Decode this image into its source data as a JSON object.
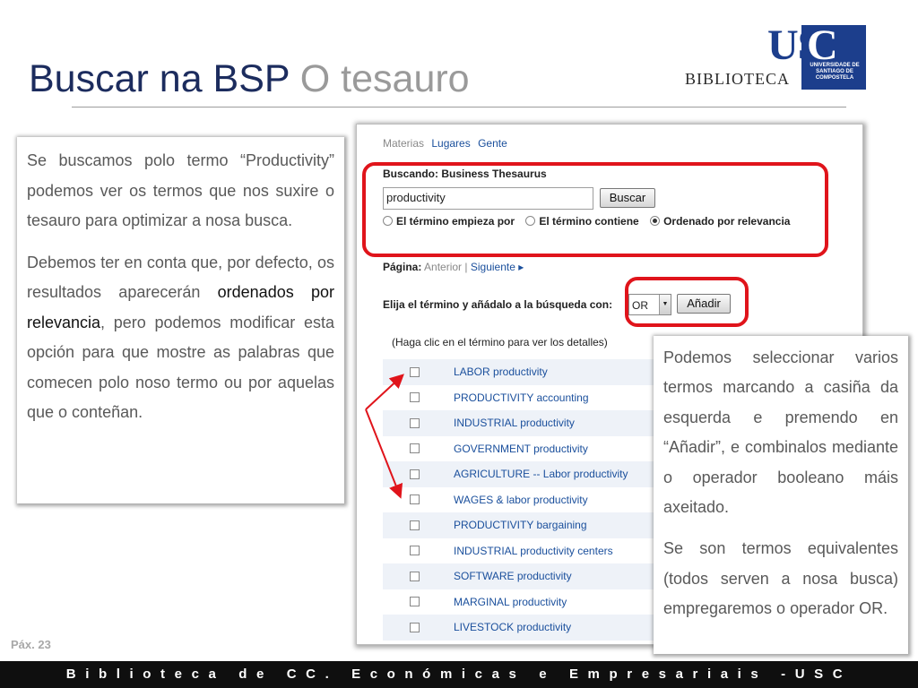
{
  "header": {
    "title_main": "Buscar na BSP",
    "title_sub": "O tesauro",
    "logo_usc": "USC",
    "logo_university": "UNIVERSIDADE DE SANTIAGO DE COMPOSTELA",
    "logo_biblioteca": "BIBLIOTECA"
  },
  "left_box": {
    "p1": "Se buscamos polo termo “Productivity” podemos ver os termos que nos suxire o tesauro para optimizar a nosa busca.",
    "p2_before": "Debemos ter en conta que, por defecto, os resultados aparecerán ",
    "p2_highlight": "ordenados por relevancia",
    "p2_after": ", pero podemos modificar esta opción para que mostre as palabras que comecen polo noso termo ou por aquelas que o conteñan."
  },
  "panel": {
    "tabs": {
      "materias": "Materias",
      "lugares": "Lugares",
      "gente": "Gente"
    },
    "search_label": "Buscando: Business Thesaurus",
    "search_value": "productivity",
    "search_button": "Buscar",
    "radio_options": [
      "El término empieza por",
      "El término contiene",
      "Ordenado por relevancia"
    ],
    "radio_selected_index": 2,
    "page_label": "Página:",
    "page_prev": "Anterior",
    "page_next": "Siguiente ▸",
    "choose_label": "Elija el término y añádalo a la búsqueda con:",
    "operator_value": "OR",
    "add_button": "Añadir",
    "hint": "(Haga clic en el término para ver los detalles)",
    "terms": [
      "LABOR productivity",
      "PRODUCTIVITY accounting",
      "INDUSTRIAL productivity",
      "GOVERNMENT productivity",
      "AGRICULTURE -- Labor productivity",
      "WAGES & labor productivity",
      "PRODUCTIVITY bargaining",
      "INDUSTRIAL productivity centers",
      "SOFTWARE productivity",
      "MARGINAL productivity",
      "LIVESTOCK productivity"
    ]
  },
  "right_box": {
    "p1": "Podemos seleccionar varios termos marcando a casiña da esquerda e premendo en “Añadir”, e combinalos mediante o operador booleano máis axeitado.",
    "p2": "Se son termos equivalentes (todos serven a nosa busca) empregaremos o operador OR."
  },
  "footer": {
    "page_number": "Páx. 23",
    "text": "Biblioteca de CC. Económicas e Empresariais -USC"
  },
  "colors": {
    "title": "#1c2c5e",
    "highlight_box": "#e0141b",
    "footer": "#0f0f0f",
    "link": "#1a4f9c"
  }
}
